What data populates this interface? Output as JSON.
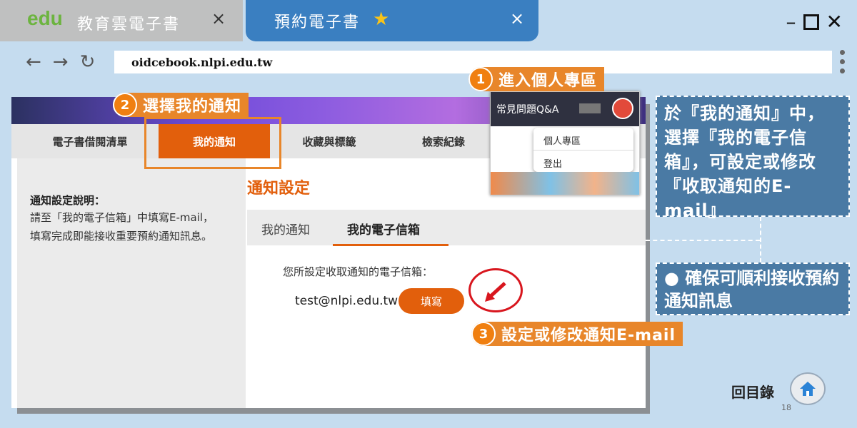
{
  "browser": {
    "tab1_title": "教育雲電子書",
    "tab1_logo": "edu",
    "tab2_title": "預約電子書",
    "close_glyph": "×",
    "url": "oidcebook.nlpi.edu.tw"
  },
  "site": {
    "nav": [
      "電子書借閱清單",
      "我的通知",
      "收藏與標籤",
      "檢索紀錄"
    ],
    "left_title": "通知設定說明：",
    "left_body": "請至「我的電子信箱」中填寫E-mail，填寫完成即能接收重要預約通知訊息。",
    "section_title": "通知設定",
    "subtabs": [
      "我的通知",
      "我的電子信箱"
    ],
    "email_label": "您所設定收取通知的電子信箱：",
    "email_value": "test@nlpi.edu.tw",
    "fill_button": "填寫"
  },
  "popup": {
    "header_text": "常見問題Q&A",
    "menu": [
      "個人專區",
      "登出"
    ]
  },
  "steps": [
    {
      "num": "1",
      "text": "進入個人專區"
    },
    {
      "num": "2",
      "text": "選擇我的通知"
    },
    {
      "num": "3",
      "text": "設定或修改通知E-mail"
    }
  ],
  "info1": "於『我的通知』中，選擇『我的電子信箱』，可設定或修改『收取通知的E-mail』",
  "info2": "● 確保可順利接收預約通知訊息",
  "home_label": "回目錄",
  "page_number": "18"
}
